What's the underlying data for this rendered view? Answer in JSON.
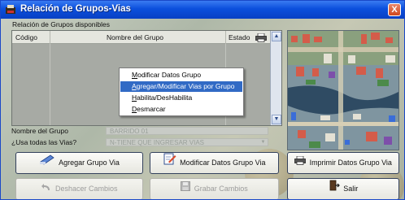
{
  "window": {
    "title": "Relación de Grupos-Vias",
    "close_label": "X"
  },
  "panel": {
    "label": "Relación de Grupos disponibles"
  },
  "grid": {
    "columns": [
      "Código",
      "Nombre del Grupo",
      "Estado"
    ],
    "rows": []
  },
  "context_menu": {
    "items": [
      {
        "label": "Modificar Datos Grupo",
        "selected": false
      },
      {
        "label": "Agregar/Modificar Vias por Grupo",
        "selected": true
      },
      {
        "label": "Habilita/DesHabilita",
        "selected": false
      },
      {
        "label": "Desmarcar",
        "selected": false
      }
    ]
  },
  "form": {
    "nombre_label": "Nombre del Grupo",
    "nombre_value": "BARRIDO 01",
    "usa_vias_label": "¿Usa todas las Vias?",
    "usa_vias_value": "N-TIENE QUE INGRESAR VIAS"
  },
  "buttons": {
    "agregar": "Agregar Grupo Via",
    "modificar": "Modificar Datos Grupo Via",
    "imprimir": "Imprimir Datos Grupo Via",
    "deshacer": "Deshacer Cambios",
    "grabar": "Grabar Cambios",
    "salir": "Salir"
  },
  "colors": {
    "title_bar": "#0b4fdc",
    "menu_highlight": "#316ac5",
    "background": "#b9c1b4"
  }
}
